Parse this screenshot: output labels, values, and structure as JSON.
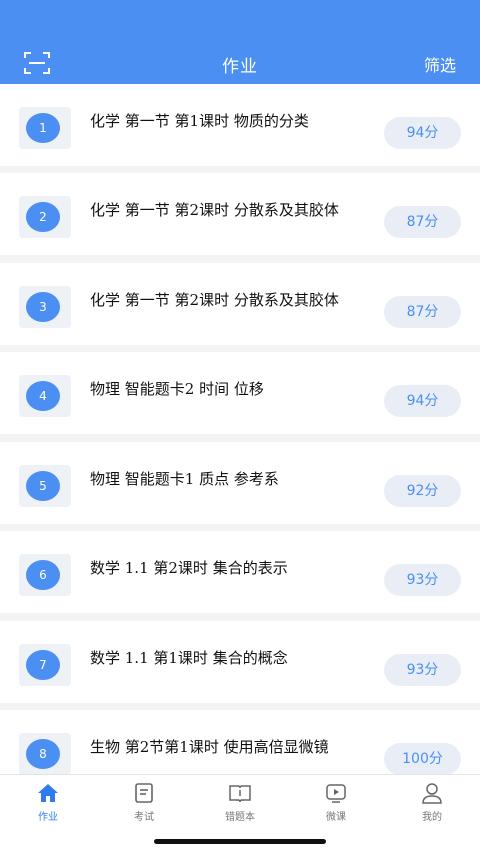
{
  "header": {
    "title": "作业",
    "filter_label": "筛选",
    "scan_icon": "scan-icon"
  },
  "homework": [
    {
      "num": "1",
      "title": "化学  第一节 第1课时 物质的分类",
      "score": "94分"
    },
    {
      "num": "2",
      "title": "化学  第一节 第2课时 分散系及其胶体",
      "score": "87分"
    },
    {
      "num": "3",
      "title": "化学  第一节 第2课时 分散系及其胶体",
      "score": "87分"
    },
    {
      "num": "4",
      "title": "物理  智能题卡2    时间    位移",
      "score": "94分"
    },
    {
      "num": "5",
      "title": "物理  智能题卡1    质点    参考系",
      "score": "92分"
    },
    {
      "num": "6",
      "title": "数学  1.1 第2课时 集合的表示",
      "score": "93分"
    },
    {
      "num": "7",
      "title": "数学  1.1 第1课时 集合的概念",
      "score": "93分"
    },
    {
      "num": "8",
      "title": "生物  第2节第1课时    使用高倍显微镜",
      "score": "100分"
    }
  ],
  "tabs": [
    {
      "label": "作业",
      "icon": "home-icon",
      "active": true
    },
    {
      "label": "考试",
      "icon": "exam-icon"
    },
    {
      "label": "错题本",
      "icon": "notebook-icon"
    },
    {
      "label": "微课",
      "icon": "video-icon"
    },
    {
      "label": "我的",
      "icon": "user-icon"
    }
  ],
  "colors": {
    "primary": "#4b8ff3",
    "score_bg": "#e9eef6",
    "background": "#f2f3f5"
  }
}
